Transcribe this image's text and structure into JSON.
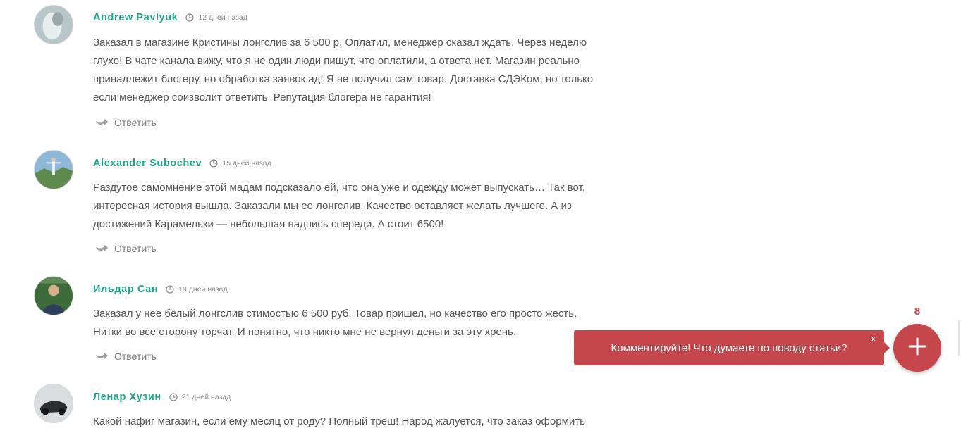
{
  "comments": [
    {
      "author": "Andrew Pavlyuk",
      "date": "12 дней назад",
      "lines": [
        "Заказал в магазине Кристины лонгслив за 6 500 р. Оплатил, менеджер сказал ждать. Через неделю",
        "глухо! В чате канала вижу, что я не один люди пишут, что оплатили, а ответа нет. Магазин реально",
        "принадлежит блогеру, но обработка заявок ад! Я не получил сам товар. Доставка СДЭКом, но только",
        "если менеджер соизволит ответить. Репутация блогера не гарантия!"
      ],
      "reply": "Ответить"
    },
    {
      "author": "Alexander Subochev",
      "date": "15 дней назад",
      "lines": [
        "Раздутое самомнение этой мадам подсказало ей, что она уже и одежду может выпускать… Так вот,",
        "интересная история вышла. Заказали мы ее лонгслив. Качество оставляет желать лучшего. А из",
        "достижений Карамельки — небольшая надпись спереди. А стоит 6500!"
      ],
      "reply": "Ответить"
    },
    {
      "author": "Ильдар Сан",
      "date": "19 дней назад",
      "lines": [
        "Заказал у нее белый лонгслив стимостью 6 500 руб. Товар пришел, но качество его просто жесть.",
        "Нитки во все сторону торчат. И понятно, что никто мне не вернул деньги за эту хрень."
      ],
      "reply": "Ответить"
    },
    {
      "author": "Ленар Хузин",
      "date": "21 дней назад",
      "lines": [
        "Какой нафиг магазин, если ему месяц от роду? Полный треш! Народ жалуется, что заказ оформить"
      ],
      "reply": ""
    }
  ],
  "widget": {
    "prompt": "Комментируйте! Что думаете по поводу статьи?",
    "close": "x",
    "count": "8"
  },
  "colors": {
    "author": "#21a48c",
    "accent": "#c6474b",
    "text": "#555555",
    "meta": "#8a8a8a"
  },
  "icons": {
    "date": "clock-icon",
    "reply": "reply-arrow-icon",
    "add": "plus-icon"
  }
}
